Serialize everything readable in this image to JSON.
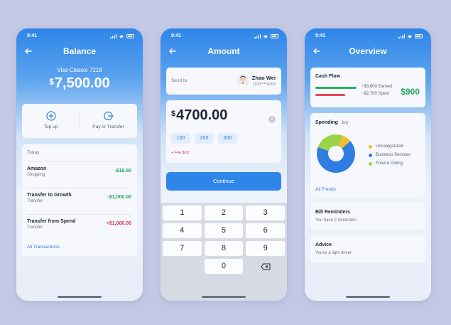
{
  "status": {
    "time": "9:41"
  },
  "balance_screen": {
    "title": "Balance",
    "card_name": "Visa Classic 7218",
    "currency": "$",
    "amount": "7,500.00",
    "actions": [
      {
        "label": "Top up",
        "icon": "plus-circle-icon"
      },
      {
        "label": "Pay or Transfer",
        "icon": "transfer-arrow-icon"
      }
    ],
    "section": "Today",
    "transactions": [
      {
        "name": "Amazon",
        "category": "Shopping",
        "amount": "-$16.80",
        "color": "#27a55a"
      },
      {
        "name": "Transfer to Growth",
        "category": "Transfer",
        "amount": "-$1,000.00",
        "color": "#27a55a"
      },
      {
        "name": "Transfer from Spend",
        "category": "Transfer",
        "amount": "+$1,000.00",
        "color": "#e0364f"
      }
    ],
    "all_link": "All Transactions"
  },
  "amount_screen": {
    "title": "Amount",
    "send_to_label": "Send to",
    "recipient_name": "Zhao Wei",
    "recipient_number": "1100****4253",
    "currency": "$",
    "amount": "4700.00",
    "clear_icon": "clear-icon",
    "presets": [
      "100",
      "200",
      "300"
    ],
    "fee": "+ Fee $10",
    "continue_label": "Continue",
    "keys": [
      "1",
      "2",
      "3",
      "4",
      "5",
      "6",
      "7",
      "8",
      "9",
      "",
      "0",
      ""
    ]
  },
  "overview_screen": {
    "title": "Overview",
    "cash_flow": {
      "title": "Cash Flow",
      "earned": "~$3,600 Earned",
      "spent": "~$2,700 Spent",
      "net": "$900",
      "earned_color": "#27b35a",
      "spent_color": "#e8475c"
    },
    "spending": {
      "title": "Spending",
      "month": "July",
      "legend": [
        {
          "label": "Uncategorized",
          "color": "#f3bf2a",
          "share": 0.08
        },
        {
          "label": "Business Services",
          "color": "#2f7de1",
          "share": 0.67
        },
        {
          "label": "Food & Dining",
          "color": "#9bd44a",
          "share": 0.25
        }
      ],
      "all_link": "All Trends"
    },
    "bill_reminders": {
      "title": "Bill Reminders",
      "subtitle": "You have 2 reminders"
    },
    "advice": {
      "title": "Advice",
      "subtitle": "You're a light driver"
    }
  }
}
